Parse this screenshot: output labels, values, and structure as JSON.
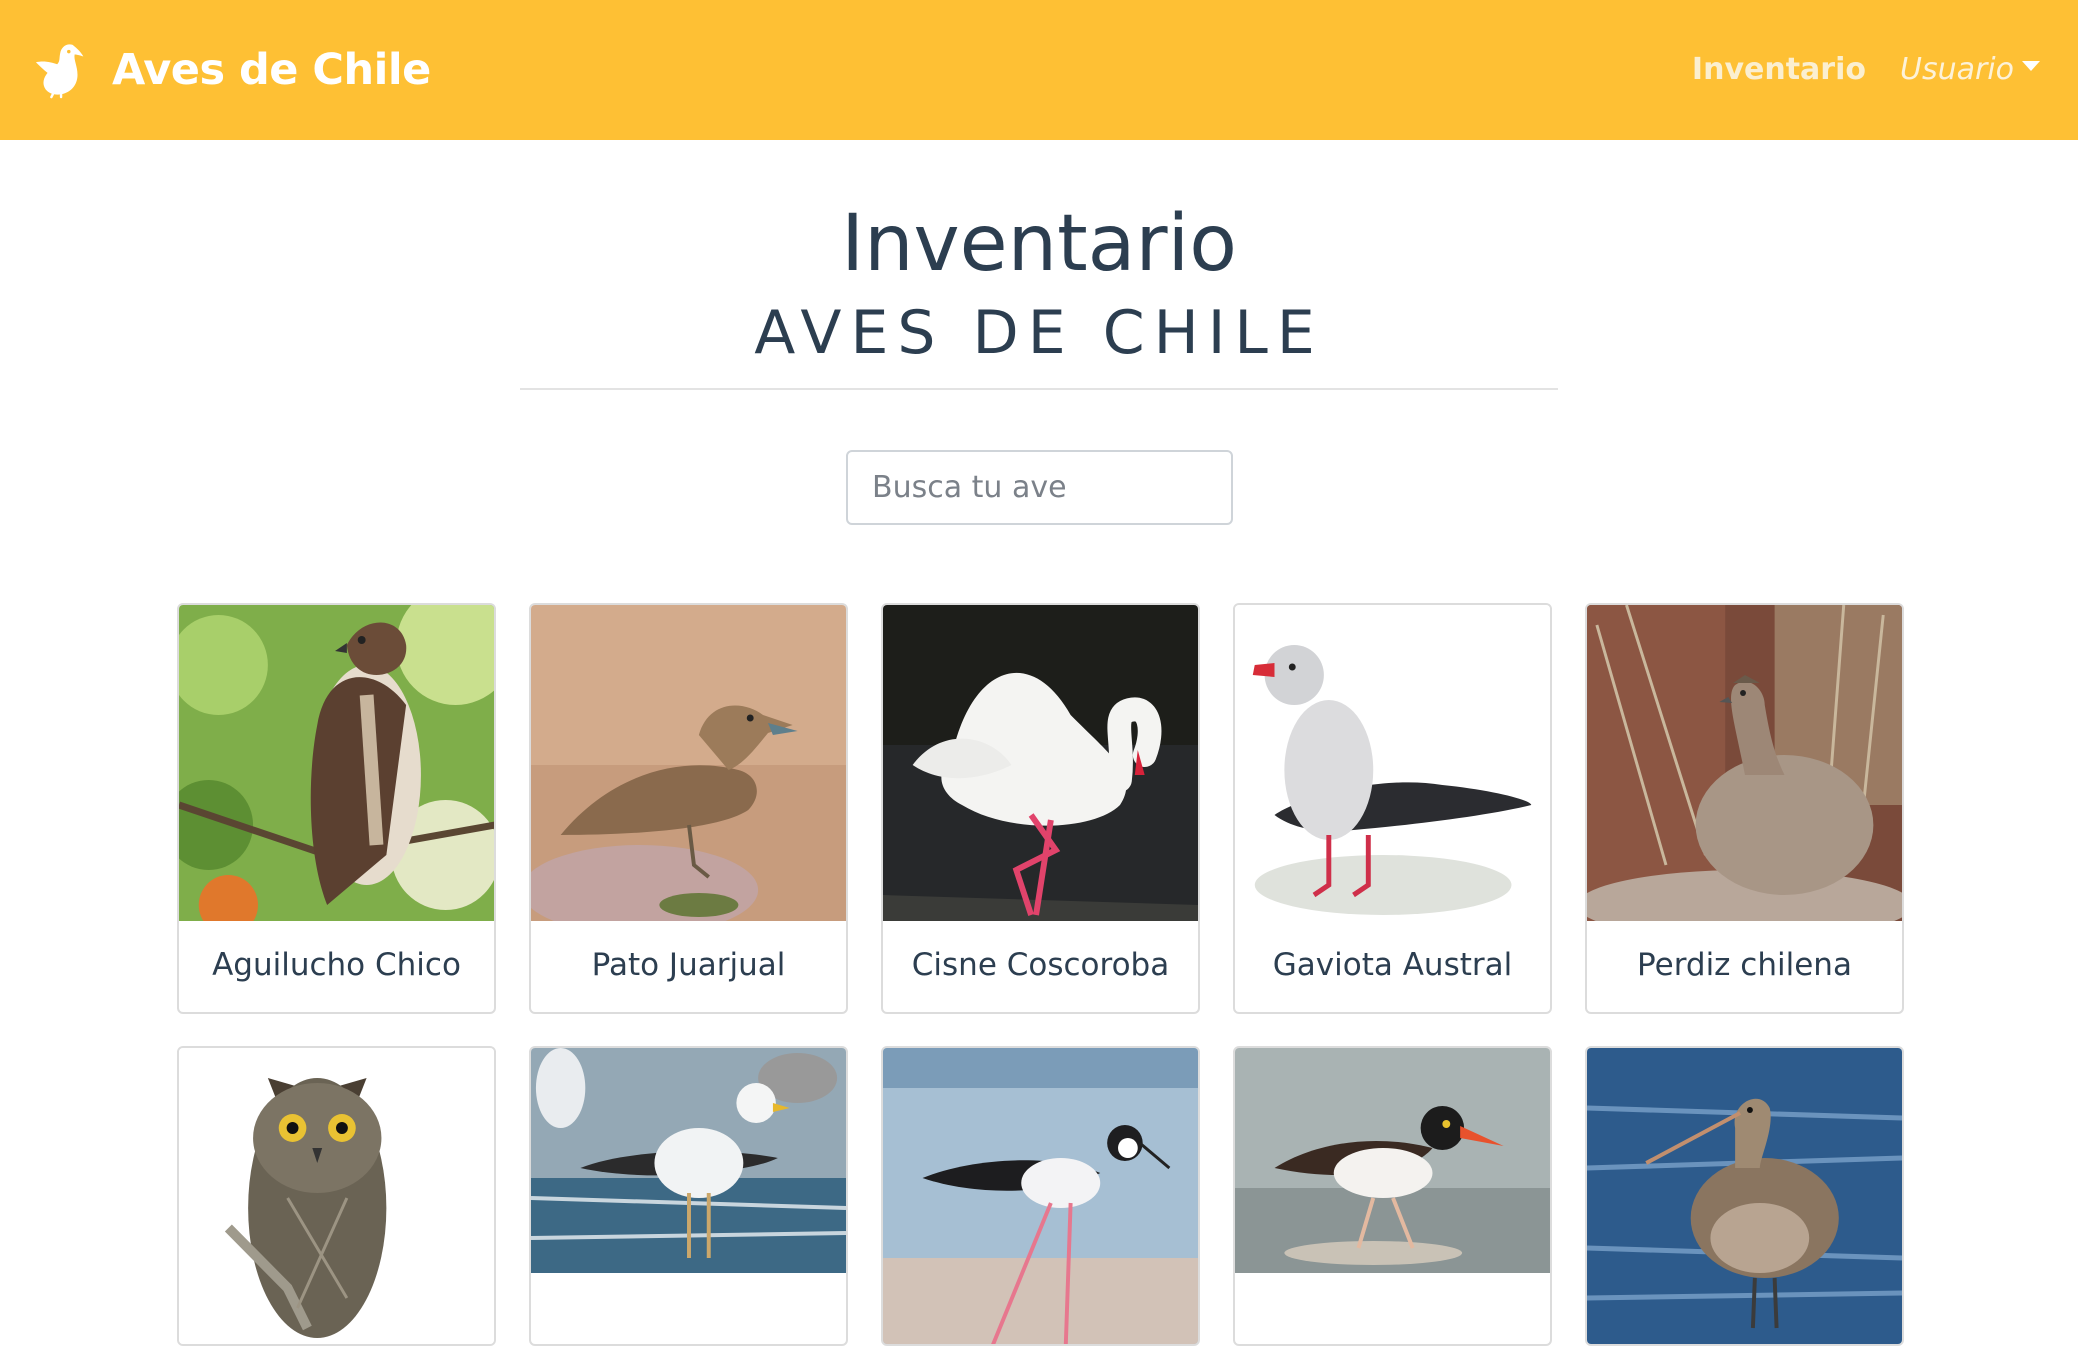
{
  "navbar": {
    "brand": "Aves de Chile",
    "links": [
      {
        "label": "Inventario"
      },
      {
        "label": "Usuario",
        "icon": "caret-down-icon"
      }
    ],
    "color": "#fec034"
  },
  "header": {
    "title": "Inventario",
    "subtitle": "AVES DE CHILE"
  },
  "search": {
    "placeholder": "Busca tu ave",
    "value": ""
  },
  "birds": [
    {
      "name": "Aguilucho Chico"
    },
    {
      "name": "Pato Juarjual"
    },
    {
      "name": "Cisne Coscoroba"
    },
    {
      "name": "Gaviota Austral"
    },
    {
      "name": "Perdiz chilena"
    },
    {
      "name": ""
    },
    {
      "name": ""
    },
    {
      "name": ""
    },
    {
      "name": ""
    },
    {
      "name": ""
    }
  ]
}
